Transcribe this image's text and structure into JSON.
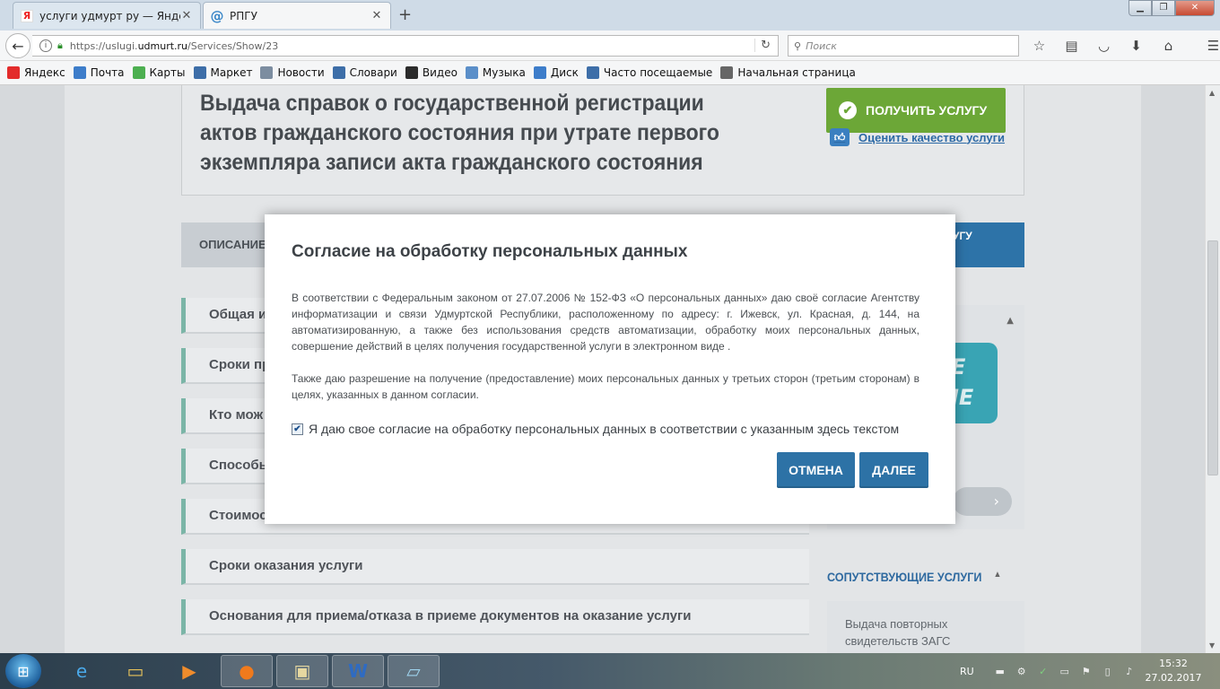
{
  "browser": {
    "tabs": [
      {
        "title": "услуги удмурт ру — Янде...",
        "favicon": "yandex-icon",
        "active": false
      },
      {
        "title": "РПГУ",
        "favicon": "at-sign-icon",
        "active": true
      }
    ],
    "url_prefix": "https://uslugi.",
    "url_host": "udmurt.ru",
    "url_path": "/Services/Show/23",
    "search_placeholder": "Поиск",
    "bookmarks": [
      {
        "label": "Яндекс",
        "icon": "yandex-icon",
        "color": "#e32b2b"
      },
      {
        "label": "Почта",
        "icon": "mail-icon",
        "color": "#3d7dca"
      },
      {
        "label": "Карты",
        "icon": "maps-icon",
        "color": "#4caf50"
      },
      {
        "label": "Маркет",
        "icon": "market-icon",
        "color": "#3d6ea8"
      },
      {
        "label": "Новости",
        "icon": "news-icon",
        "color": "#7c8da0"
      },
      {
        "label": "Словари",
        "icon": "dictionary-icon",
        "color": "#3d6ea8"
      },
      {
        "label": "Видео",
        "icon": "video-icon",
        "color": "#2b2b2b"
      },
      {
        "label": "Музыка",
        "icon": "music-icon",
        "color": "#5b8fc9"
      },
      {
        "label": "Диск",
        "icon": "disk-icon",
        "color": "#3d7dca"
      },
      {
        "label": "Часто посещаемые",
        "icon": "frequent-icon",
        "color": "#3d6ea8"
      },
      {
        "label": "Начальная страница",
        "icon": "globe-icon",
        "color": "#666666"
      }
    ]
  },
  "page": {
    "service_title": "Выдача справок о государственной регистрации актов гражданского состояния при утрате первого экземпляра записи акта гражданского состояния",
    "get_service_label": "ПОЛУЧИТЬ УСЛУГУ",
    "rate_label": "Оценить качество услуги",
    "tab_description": "ОПИСАНИЕ",
    "tab_right_partial": "УГУ",
    "sections": [
      "Общая и",
      "Сроки пр",
      "Кто мож",
      "Способы",
      "Стоимос",
      "Сроки оказания услуги",
      "Основания для приема/отказа в приеме документов на оказание услуги"
    ],
    "promo_text_1": "E",
    "promo_text_2": "IE",
    "related_title": "СОПУТСТВУЮЩИЕ УСЛУГИ",
    "related_item": "Выдача повторных свидетельств ЗАГС"
  },
  "modal": {
    "title": "Согласие на обработку персональных данных",
    "paragraph_1": "В соответствии с Федеральным законом от 27.07.2006 № 152-ФЗ «О персональных данных» даю своё согласие Агентству информатизации и связи Удмуртской Республики, расположенному по адресу: г. Ижевск, ул. Красная, д. 144, на автоматизированную, а также без использования средств автоматизации, обработку моих персональных данных, совершение действий в целях получения государственной услуги в электронном виде .",
    "paragraph_2": "Также даю разрешение на получение (предоставление) моих персональных данных у третьих сторон (третьим сторонам) в целях, указанных в данном согласии.",
    "consent_label": "Я даю свое согласие на обработку персональных данных в соответствии с указанным здесь текстом",
    "consent_checked": true,
    "cancel_label": "ОТМЕНА",
    "next_label": "ДАЛЕЕ"
  },
  "taskbar": {
    "language": "RU",
    "time": "15:32",
    "date": "27.02.2017"
  },
  "colors": {
    "accent_blue": "#2d72a6",
    "accent_green": "#6ca737",
    "accordion_border": "#7bb5a7"
  }
}
